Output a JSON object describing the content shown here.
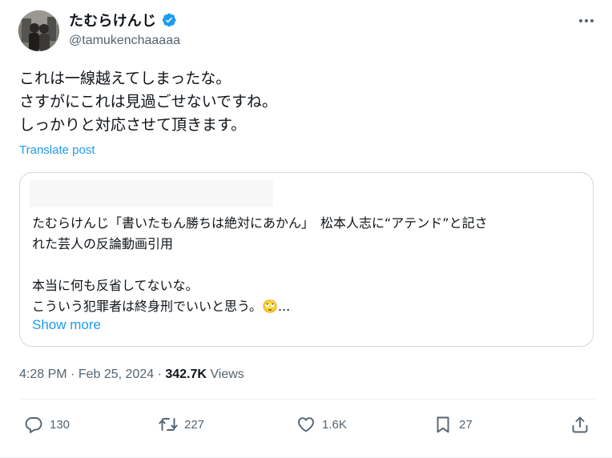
{
  "author": {
    "display_name": "たむらけんじ",
    "handle": "@tamukenchaaaaa",
    "verified": true,
    "avatar_icon": "profile-photo-two-people",
    "more_icon": "more-dots-icon"
  },
  "tweet": {
    "lines": [
      "これは一線越えてしまったな。",
      "さすがにこれは見過ごせないですね。",
      "しっかりと対応させて頂きます。"
    ],
    "translate_label": "Translate post"
  },
  "quote": {
    "line1": "たむらけんじ「書いたもん勝ちは絶対にあかん」　松本人志に“アテンド”と記さ",
    "line2": "れた芸人の反論動画引用",
    "line3": "本当に何も反省してないな。",
    "line4": "こういう犯罪者は終身刑でいいと思う。🙄...",
    "show_more": "Show more"
  },
  "meta": {
    "time": "4:28 PM",
    "sep1": " · ",
    "date": "Feb 25, 2024",
    "sep2": " · ",
    "views_count": "342.7K",
    "views_label": " Views"
  },
  "actions": {
    "replies": "130",
    "reposts": "227",
    "likes": "1.6K",
    "bookmarks": "27"
  },
  "colors": {
    "accent": "#1d9bf0",
    "secondary_text": "#536471",
    "border": "#cfd9de"
  }
}
